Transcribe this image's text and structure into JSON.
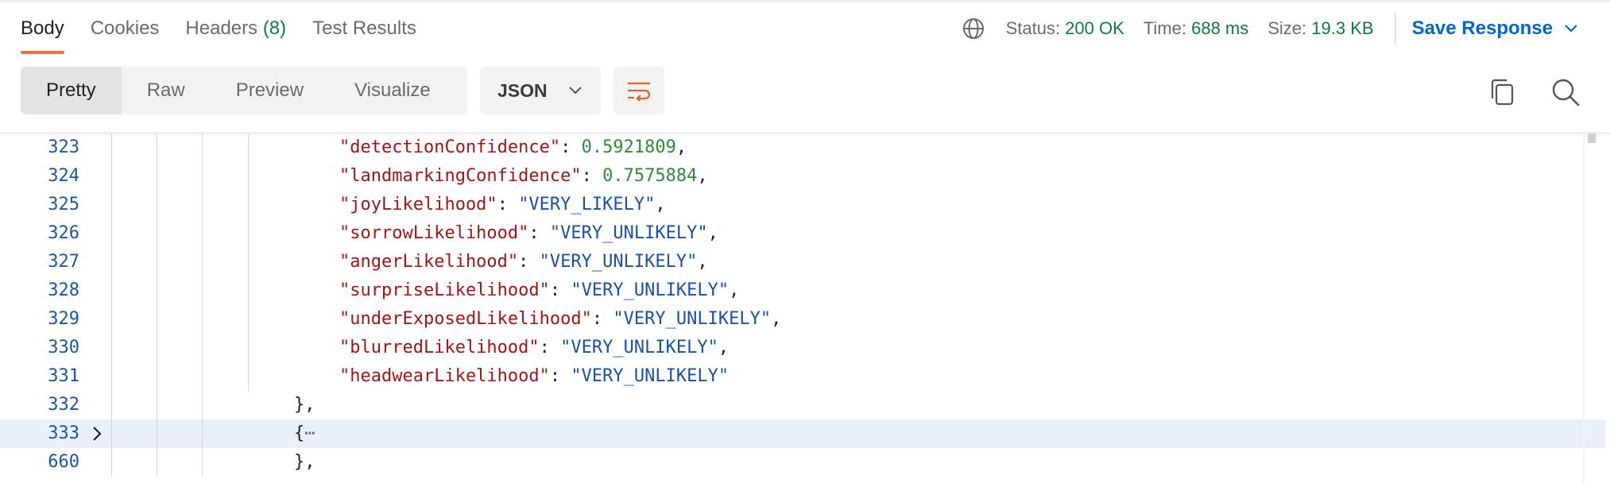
{
  "response_tabs": {
    "body": "Body",
    "cookies": "Cookies",
    "headers_label": "Headers",
    "headers_count": "(8)",
    "test_results": "Test Results"
  },
  "status": {
    "status_label": "Status:",
    "status_value": "200 OK",
    "time_label": "Time:",
    "time_value": "688 ms",
    "size_label": "Size:",
    "size_value": "19.3 KB",
    "save_response": "Save Response"
  },
  "view_modes": [
    "Pretty",
    "Raw",
    "Preview",
    "Visualize"
  ],
  "format": "JSON",
  "colors": {
    "accent_orange": "#ff6c37",
    "status_green": "#0f7b3c",
    "link_blue": "#0265d2",
    "json_key": "#a31515",
    "json_string": "#1b4fa8",
    "json_number": "#2f8a3b",
    "line_number": "#1d56a8",
    "highlight_row": "#e9f0fc"
  },
  "icons": [
    "globe-icon",
    "chevron-down-icon",
    "word-wrap-icon",
    "copy-icon",
    "search-icon",
    "chevron-right-icon"
  ],
  "editor": {
    "lines": [
      {
        "num": "323",
        "key": "\"detectionConfidence\"",
        "sep": ": ",
        "val": "0.5921809",
        "type": "number",
        "tail": ","
      },
      {
        "num": "324",
        "key": "\"landmarkingConfidence\"",
        "sep": ": ",
        "val": "0.7575884",
        "type": "number",
        "tail": ","
      },
      {
        "num": "325",
        "key": "\"joyLikelihood\"",
        "sep": ": ",
        "val": "\"VERY_LIKELY\"",
        "type": "string",
        "tail": ","
      },
      {
        "num": "326",
        "key": "\"sorrowLikelihood\"",
        "sep": ": ",
        "val": "\"VERY_UNLIKELY\"",
        "type": "string",
        "tail": ","
      },
      {
        "num": "327",
        "key": "\"angerLikelihood\"",
        "sep": ": ",
        "val": "\"VERY_UNLIKELY\"",
        "type": "string",
        "tail": ","
      },
      {
        "num": "328",
        "key": "\"surpriseLikelihood\"",
        "sep": ": ",
        "val": "\"VERY_UNLIKELY\"",
        "type": "string",
        "tail": ","
      },
      {
        "num": "329",
        "key": "\"underExposedLikelihood\"",
        "sep": ": ",
        "val": "\"VERY_UNLIKELY\"",
        "type": "string",
        "tail": ","
      },
      {
        "num": "330",
        "key": "\"blurredLikelihood\"",
        "sep": ": ",
        "val": "\"VERY_UNLIKELY\"",
        "type": "string",
        "tail": ","
      },
      {
        "num": "331",
        "key": "\"headwearLikelihood\"",
        "sep": ": ",
        "val": "\"VERY_UNLIKELY\"",
        "type": "string",
        "tail": ""
      },
      {
        "num": "332",
        "text": "},"
      },
      {
        "num": "333",
        "text": "{",
        "ellipsis": "⋯",
        "folded": true
      },
      {
        "num": "660",
        "text": "},"
      }
    ]
  }
}
